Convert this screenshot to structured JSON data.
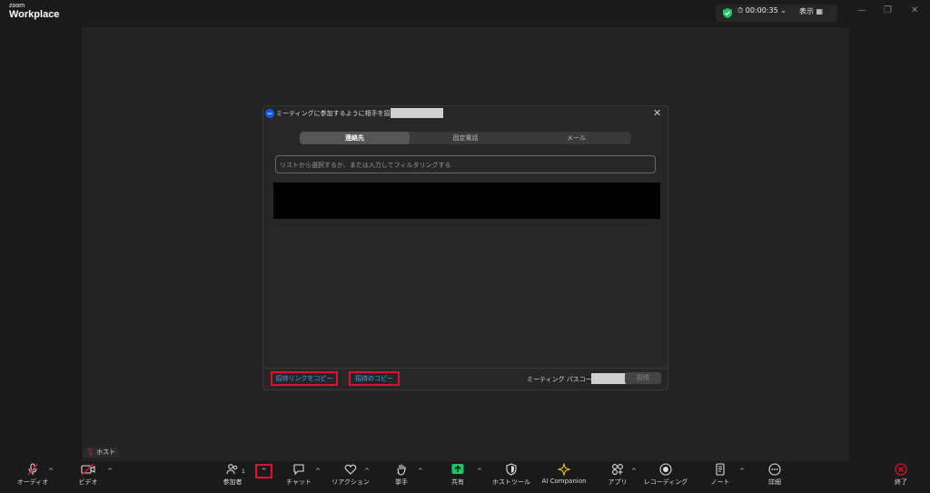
{
  "app": {
    "brand_small": "zoom",
    "brand_big": "Workplace"
  },
  "status": {
    "timer": "00:00:35",
    "view_label": "表示"
  },
  "host_label": "ホスト",
  "dialog": {
    "title": "ミーティングに参加するように相手を招待",
    "tabs": [
      {
        "label": "連絡先",
        "active": true
      },
      {
        "label": "固定電話",
        "active": false
      },
      {
        "label": "メール",
        "active": false
      }
    ],
    "search_placeholder": "リストから選択するか、または入力してフィルタリングする",
    "copy_link_label": "招待リンクをコピー",
    "copy_invite_label": "招待のコピー",
    "passcode_label": "ミーティング パスコード:",
    "invite_button": "招待"
  },
  "toolbar": {
    "audio": "オーディオ",
    "video": "ビデオ",
    "participants": "参加者",
    "participant_count": "1",
    "chat": "チャット",
    "reactions": "リアクション",
    "raise_hand": "挙手",
    "share": "共有",
    "host_tools": "ホストツール",
    "ai_companion": "AI Companion",
    "apps": "アプリ",
    "recording": "レコーディング",
    "notes": "ノート",
    "more": "詳細",
    "end": "終了"
  },
  "colors": {
    "accent_red": "#e0102e",
    "link_blue": "#4aa3ff",
    "share_green": "#17c964",
    "zoom_blue": "#0b5cff",
    "ai_gold": "#f5c518"
  }
}
